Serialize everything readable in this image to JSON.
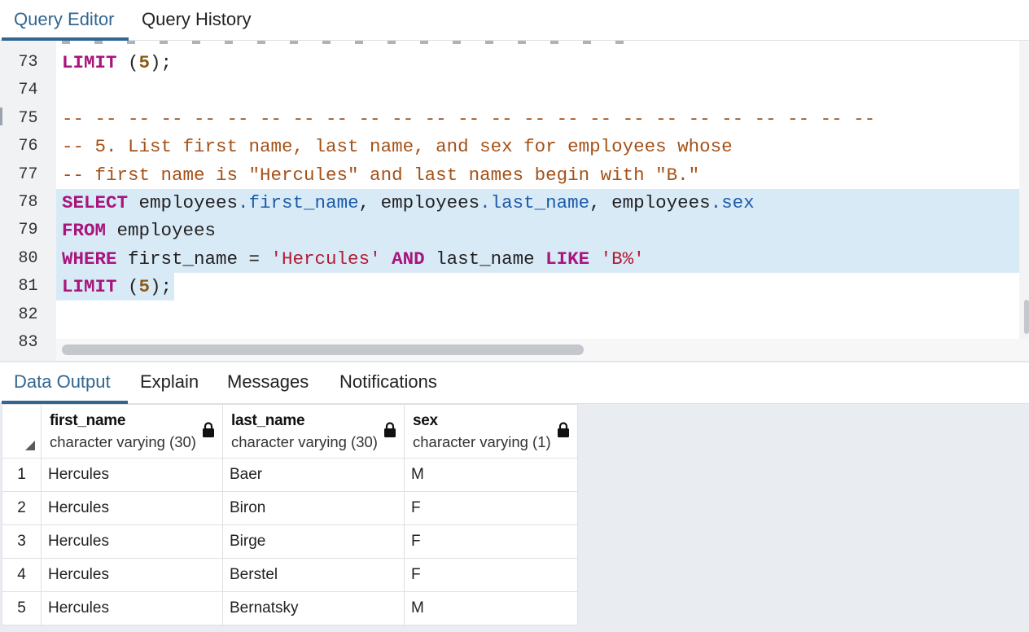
{
  "top_tabs": [
    {
      "label": "Query Editor",
      "active": true
    },
    {
      "label": "Query History",
      "active": false
    }
  ],
  "editor": {
    "lines": [
      {
        "n": "73",
        "tokens": [
          [
            "kw",
            "LIMIT"
          ],
          [
            "plain",
            " ("
          ],
          [
            "num",
            "5"
          ],
          [
            "plain",
            ");"
          ]
        ]
      },
      {
        "n": "74",
        "tokens": []
      },
      {
        "n": "75",
        "tokens": [
          [
            "cm",
            "-- -- -- -- -- -- -- -- -- -- -- -- -- -- -- -- -- -- -- -- -- -- -- -- --"
          ]
        ]
      },
      {
        "n": "76",
        "tokens": [
          [
            "cm",
            "-- 5. List first name, last name, and sex for employees whose"
          ]
        ]
      },
      {
        "n": "77",
        "tokens": [
          [
            "cm",
            "-- first name is \"Hercules\" and last names begin with \"B.\""
          ]
        ]
      },
      {
        "n": "78",
        "tokens": [
          [
            "kw",
            "SELECT"
          ],
          [
            "plain",
            " employees"
          ],
          [
            "prop",
            ".first_name"
          ],
          [
            "plain",
            ", employees"
          ],
          [
            "prop",
            ".last_name"
          ],
          [
            "plain",
            ", employees"
          ],
          [
            "prop",
            ".sex"
          ]
        ]
      },
      {
        "n": "79",
        "tokens": [
          [
            "kw",
            "FROM"
          ],
          [
            "plain",
            " employees"
          ]
        ]
      },
      {
        "n": "80",
        "tokens": [
          [
            "kw",
            "WHERE"
          ],
          [
            "plain",
            " first_name = "
          ],
          [
            "str",
            "'Hercules'"
          ],
          [
            "plain",
            " "
          ],
          [
            "kw",
            "AND"
          ],
          [
            "plain",
            " last_name "
          ],
          [
            "kw",
            "LIKE"
          ],
          [
            "plain",
            " "
          ],
          [
            "str",
            "'B%'"
          ]
        ]
      },
      {
        "n": "81",
        "tokens": [
          [
            "kw",
            "LIMIT"
          ],
          [
            "plain",
            " ("
          ],
          [
            "num",
            "5"
          ],
          [
            "plain",
            ");"
          ]
        ]
      },
      {
        "n": "82",
        "tokens": []
      },
      {
        "n": "83",
        "tokens": []
      }
    ]
  },
  "bottom_tabs": [
    {
      "label": "Data Output",
      "active": true
    },
    {
      "label": "Explain",
      "active": false
    },
    {
      "label": "Messages",
      "active": false
    },
    {
      "label": "Notifications",
      "active": false
    }
  ],
  "results": {
    "columns": [
      {
        "name": "first_name",
        "type": "character varying (30)"
      },
      {
        "name": "last_name",
        "type": "character varying (30)"
      },
      {
        "name": "sex",
        "type": "character varying (1)"
      }
    ],
    "rows": [
      {
        "num": "1",
        "cells": [
          "Hercules",
          "Baer",
          "M"
        ]
      },
      {
        "num": "2",
        "cells": [
          "Hercules",
          "Biron",
          "F"
        ]
      },
      {
        "num": "3",
        "cells": [
          "Hercules",
          "Birge",
          "F"
        ]
      },
      {
        "num": "4",
        "cells": [
          "Hercules",
          "Berstel",
          "F"
        ]
      },
      {
        "num": "5",
        "cells": [
          "Hercules",
          "Bernatsky",
          "M"
        ]
      }
    ]
  },
  "colors": {
    "accent": "#326690",
    "keyword": "#a8157c",
    "comment": "#a55118",
    "selection": "#d9eaf7"
  }
}
